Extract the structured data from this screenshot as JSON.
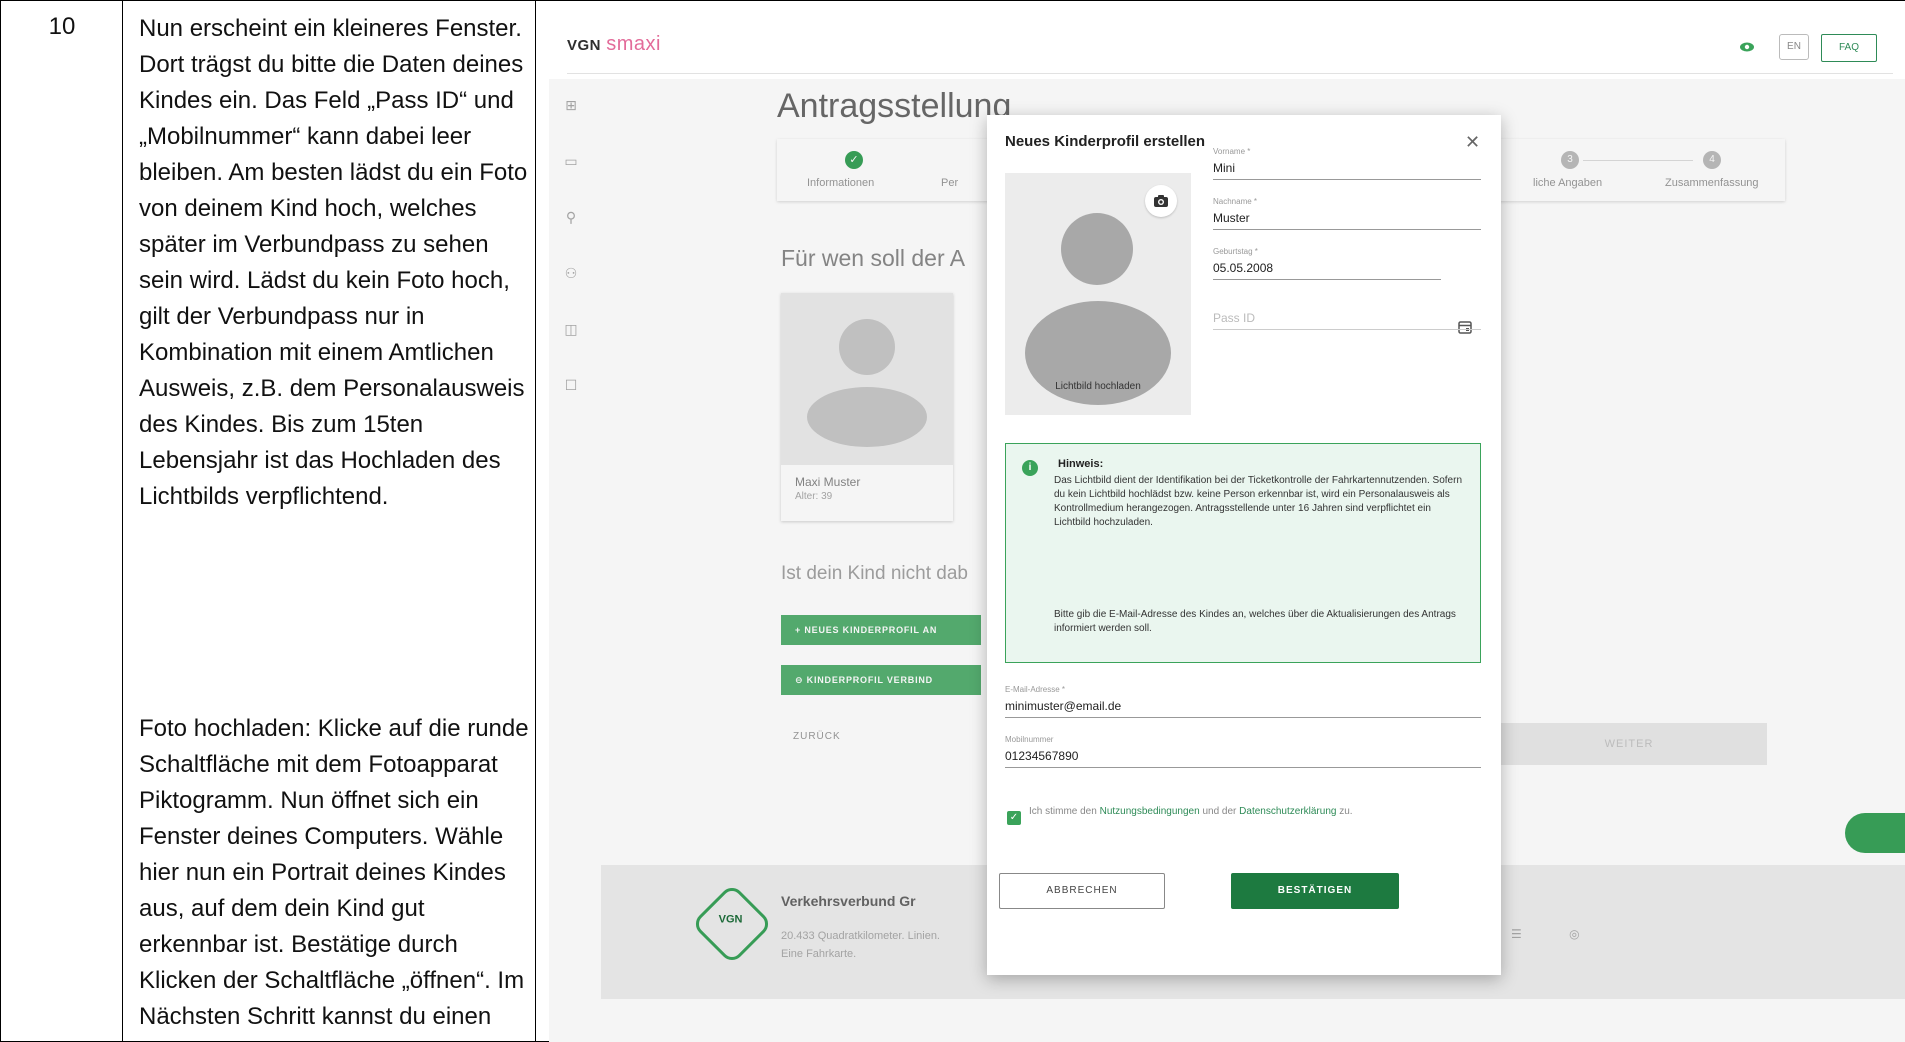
{
  "document": {
    "step_number": "10",
    "paragraph_1": "Nun erscheint ein kleineres Fenster. Dort trägst du bitte die Daten deines Kindes ein. Das Feld „Pass ID“ und „Mobilnummer“ kann dabei leer bleiben. Am besten lädst du ein Foto von deinem Kind hoch, welches später im Verbundpass zu sehen sein wird. Lädst du kein Foto hoch, gilt der Verbundpass nur in Kombination mit einem Amtlichen Ausweis, z.B. dem Personalausweis des Kindes. Bis zum 15ten Lebensjahr ist das Hochladen des Lichtbilds verpflichtend.",
    "paragraph_2": "Foto hochladen: Klicke auf die runde Schaltfläche mit dem Fotoapparat Piktogramm. Nun öffnet sich ein Fenster deines Computers. Wähle hier nun ein Portrait deines Kindes aus, auf dem dein Kind gut erkennbar ist. Bestätige durch Klicken der Schaltfläche „öffnen“. Im Nächsten Schritt kannst du einen Ausschnitt aus"
  },
  "app": {
    "logo_vgn": "VGN",
    "logo_smaxi": "smaxi",
    "header": {
      "lang": "EN",
      "faq": "FAQ"
    },
    "page_title": "Antragsstellung",
    "stepper": [
      {
        "label": "Informationen"
      },
      {
        "label": "Per"
      },
      {
        "label": "liche Angaben"
      },
      {
        "label": "Zusammenfassung"
      }
    ],
    "for_whom": "Für wen soll der A",
    "person_card": {
      "name": "Maxi Muster",
      "age": "Alter: 39"
    },
    "not_there": "Ist dein Kind nicht dab",
    "btn_new_child": "+  NEUES KINDERPROFIL AN",
    "btn_link_child": "⊖  KINDERPROFIL VERBIND",
    "btn_back": "ZURÜCK",
    "btn_weiter": "WEITER",
    "footer": {
      "logo": "VGN",
      "title": "Verkehrsverbund Gr",
      "sub": "20.433 Quadratkilometer. Linien. Eine Fahrkarte."
    }
  },
  "modal": {
    "title": "Neues Kinderprofil erstellen",
    "photo_label": "Lichtbild hochladen",
    "fields": {
      "vorname": {
        "label": "Vorname *",
        "value": "Mini"
      },
      "nachname": {
        "label": "Nachname *",
        "value": "Muster"
      },
      "geburtstag": {
        "label": "Geburtstag *",
        "value": "05.05.2008"
      },
      "pass_id": {
        "placeholder": "Pass ID"
      },
      "email": {
        "label": "E-Mail-Adresse *",
        "value": "minimuster@email.de"
      },
      "mobil": {
        "label": "Mobilnummer",
        "value": "01234567890"
      }
    },
    "hint": {
      "title": "Hinweis:",
      "text_1": "Das Lichtbild dient der Identifikation bei der Ticketkontrolle der Fahrkartennutzenden. Sofern du kein Lichtbild hochlädst bzw. keine Person erkennbar ist, wird ein Personalausweis als Kontrollmedium herangezogen. Antragsstellende unter 16 Jahren sind verpflichtet ein Lichtbild hochzuladen.",
      "text_2": "Bitte gib die E-Mail-Adresse des Kindes an, welches über die Aktualisierungen des Antrags informiert werden soll."
    },
    "consent": {
      "pre": "Ich stimme den ",
      "link_1": "Nutzungsbedingungen",
      "mid": " und der ",
      "link_2": "Datenschutzerklärung",
      "post": " zu."
    },
    "btn_cancel": "ABBRECHEN",
    "btn_confirm": "BESTÄTIGEN"
  },
  "colors": {
    "brand_green": "#3aa35a",
    "confirm_green": "#1d7a40",
    "smaxi_pink": "#e36c9a"
  }
}
